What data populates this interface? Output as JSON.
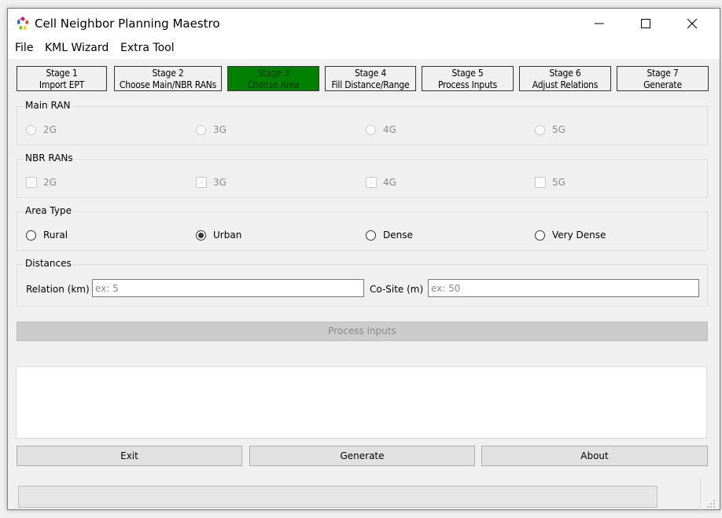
{
  "window": {
    "title": "Cell Neighbor Planning Maestro",
    "app_icon": "colorful-pentagon-logo-icon",
    "controls": {
      "minimize": "minimize-icon",
      "maximize": "maximize-icon",
      "close": "close-icon"
    }
  },
  "menu": {
    "items": [
      {
        "label": "File"
      },
      {
        "label": "KML Wizard"
      },
      {
        "label": "Extra Tool"
      }
    ]
  },
  "stages": [
    {
      "line1": "Stage 1",
      "line2": "Import EPT",
      "active": false
    },
    {
      "line1": "Stage 2",
      "line2": "Choose Main/NBR RANs",
      "active": false
    },
    {
      "line1": "Stage 3",
      "line2": "Choose Area",
      "active": true
    },
    {
      "line1": "Stage 4",
      "line2": "Fill Distance/Range",
      "active": false
    },
    {
      "line1": "Stage 5",
      "line2": "Process Inputs",
      "active": false
    },
    {
      "line1": "Stage 6",
      "line2": "Adjust Relations",
      "active": false
    },
    {
      "line1": "Stage 7",
      "line2": "Generate",
      "active": false
    }
  ],
  "colors": {
    "active_stage": "#008000",
    "active_stage_text": "#003300"
  },
  "main_ran": {
    "title": "Main RAN",
    "enabled": false,
    "options": [
      {
        "label": "2G"
      },
      {
        "label": "3G"
      },
      {
        "label": "4G"
      },
      {
        "label": "5G"
      }
    ],
    "selected": null
  },
  "nbr_rans": {
    "title": "NBR RANs",
    "enabled": false,
    "options": [
      {
        "label": "2G",
        "checked": false
      },
      {
        "label": "3G",
        "checked": false
      },
      {
        "label": "4G",
        "checked": false
      },
      {
        "label": "5G",
        "checked": false
      }
    ]
  },
  "area_type": {
    "title": "Area Type",
    "enabled": true,
    "options": [
      {
        "label": "Rural"
      },
      {
        "label": "Urban"
      },
      {
        "label": "Dense"
      },
      {
        "label": "Very Dense"
      }
    ],
    "selected": "Urban"
  },
  "distances": {
    "title": "Distances",
    "relation": {
      "label": "Relation (km)",
      "value": "",
      "placeholder": "ex: 5"
    },
    "cosite": {
      "label": "Co-Site (m)",
      "value": "",
      "placeholder": "ex: 50"
    }
  },
  "process_button": {
    "label": "Process Inputs",
    "enabled": false
  },
  "log": {
    "text": ""
  },
  "buttons": {
    "exit": "Exit",
    "generate": "Generate",
    "about": "About"
  },
  "progress": {
    "value_percent": 0
  }
}
